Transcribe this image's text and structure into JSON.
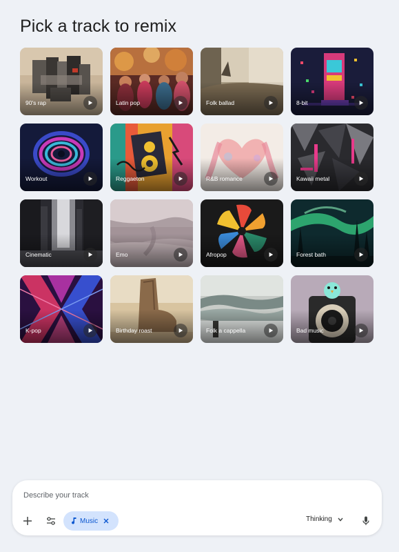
{
  "page": {
    "title": "Pick a track to remix"
  },
  "tracks": [
    {
      "label": "90's rap"
    },
    {
      "label": "Latin pop"
    },
    {
      "label": "Folk ballad"
    },
    {
      "label": "8-bit"
    },
    {
      "label": "Workout"
    },
    {
      "label": "Reggaeton"
    },
    {
      "label": "R&B romance"
    },
    {
      "label": "Kawaii metal"
    },
    {
      "label": "Cinematic"
    },
    {
      "label": "Emo"
    },
    {
      "label": "Afropop"
    },
    {
      "label": "Forest bath"
    },
    {
      "label": "K-pop"
    },
    {
      "label": "Birthday roast"
    },
    {
      "label": "Folk a cappella"
    },
    {
      "label": "Bad music"
    }
  ],
  "composer": {
    "placeholder": "Describe your track",
    "value": "",
    "add_icon": "plus-icon",
    "tools_icon": "tune-icon",
    "chip": {
      "label": "Music",
      "icon": "music-note-icon",
      "close_icon": "close-icon",
      "color": "#0b57d0",
      "background": "#d3e3fd"
    },
    "mode": {
      "label": "Thinking",
      "icon": "chevron-down-icon"
    },
    "mic_icon": "mic-icon"
  }
}
